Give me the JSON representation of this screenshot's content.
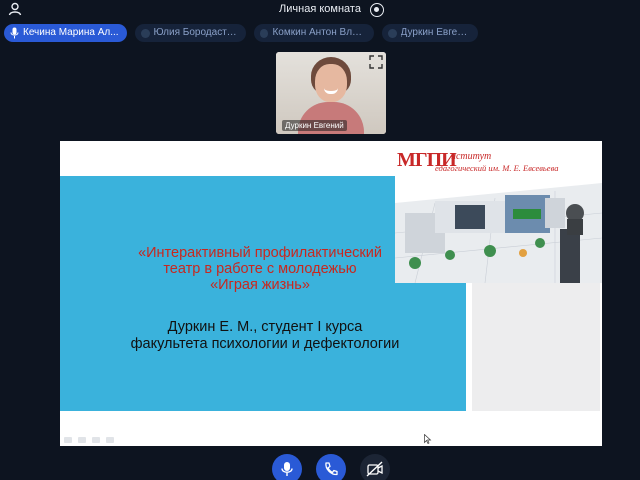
{
  "topbar": {
    "room_title": "Личная комната"
  },
  "participants": [
    {
      "name": "Кечина Марина Ал...",
      "active": true
    },
    {
      "name": "Юлия Бородастова",
      "active": false
    },
    {
      "name": "Комкин Антон Влад...",
      "active": false
    },
    {
      "name": "Дуркин Евгений",
      "active": false
    }
  ],
  "thumbnail": {
    "label": "Дуркин Евгений"
  },
  "slide": {
    "logo": "МГПИ",
    "institute_line1": "нститут",
    "institute_line2": "едагогический им. М. Е. Евсевьева",
    "title_line1": "«Интерактивный профилактический",
    "title_line2": "театр в работе с молодежью",
    "title_line3": "«Играя жизнь»",
    "author_line1": "Дуркин Е. М., студент I курса",
    "author_line2": "факультета психологии и дефектологии"
  },
  "colors": {
    "accent": "#2a5ad6",
    "slide_blue": "#3ab2dc",
    "title_red": "#c8281f"
  }
}
